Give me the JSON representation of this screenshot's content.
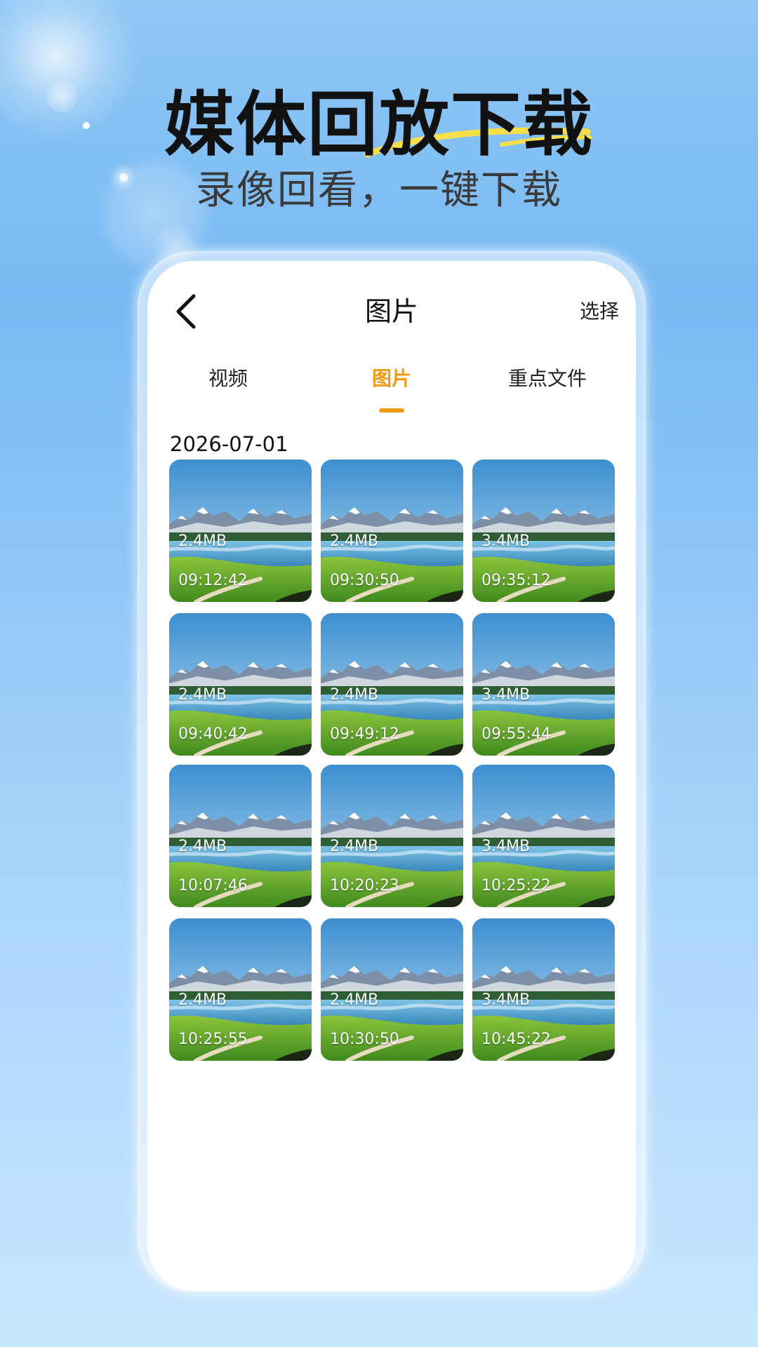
{
  "hero": {
    "title": "媒体回放下载",
    "subtitle": "录像回看，一键下载"
  },
  "nav": {
    "title": "图片",
    "select_label": "选择",
    "back_icon": "chevron-left-icon"
  },
  "tabs": [
    {
      "label": "视频",
      "active": false
    },
    {
      "label": "图片",
      "active": true
    },
    {
      "label": "重点文件",
      "active": false
    }
  ],
  "date_group": "2026-07-01",
  "items": [
    {
      "size": "2.4MB",
      "time": "09:12:42"
    },
    {
      "size": "2.4MB",
      "time": "09:30:50"
    },
    {
      "size": "3.4MB",
      "time": "09:35:12"
    },
    {
      "size": "2.4MB",
      "time": "09:40:42"
    },
    {
      "size": "2.4MB",
      "time": "09:49:12"
    },
    {
      "size": "3.4MB",
      "time": "09:55:44"
    },
    {
      "size": "2.4MB",
      "time": "10:07:46"
    },
    {
      "size": "2.4MB",
      "time": "10:20:23"
    },
    {
      "size": "3.4MB",
      "time": "10:25:22"
    },
    {
      "size": "2.4MB",
      "time": "10:25:55"
    },
    {
      "size": "2.4MB",
      "time": "10:30:50"
    },
    {
      "size": "3.4MB",
      "time": "10:45:22"
    }
  ],
  "colors": {
    "accent": "#f39a13",
    "underline_highlight": "#f6e04a",
    "background_top": "#78b9f3",
    "background_bottom": "#c9e6ff"
  }
}
